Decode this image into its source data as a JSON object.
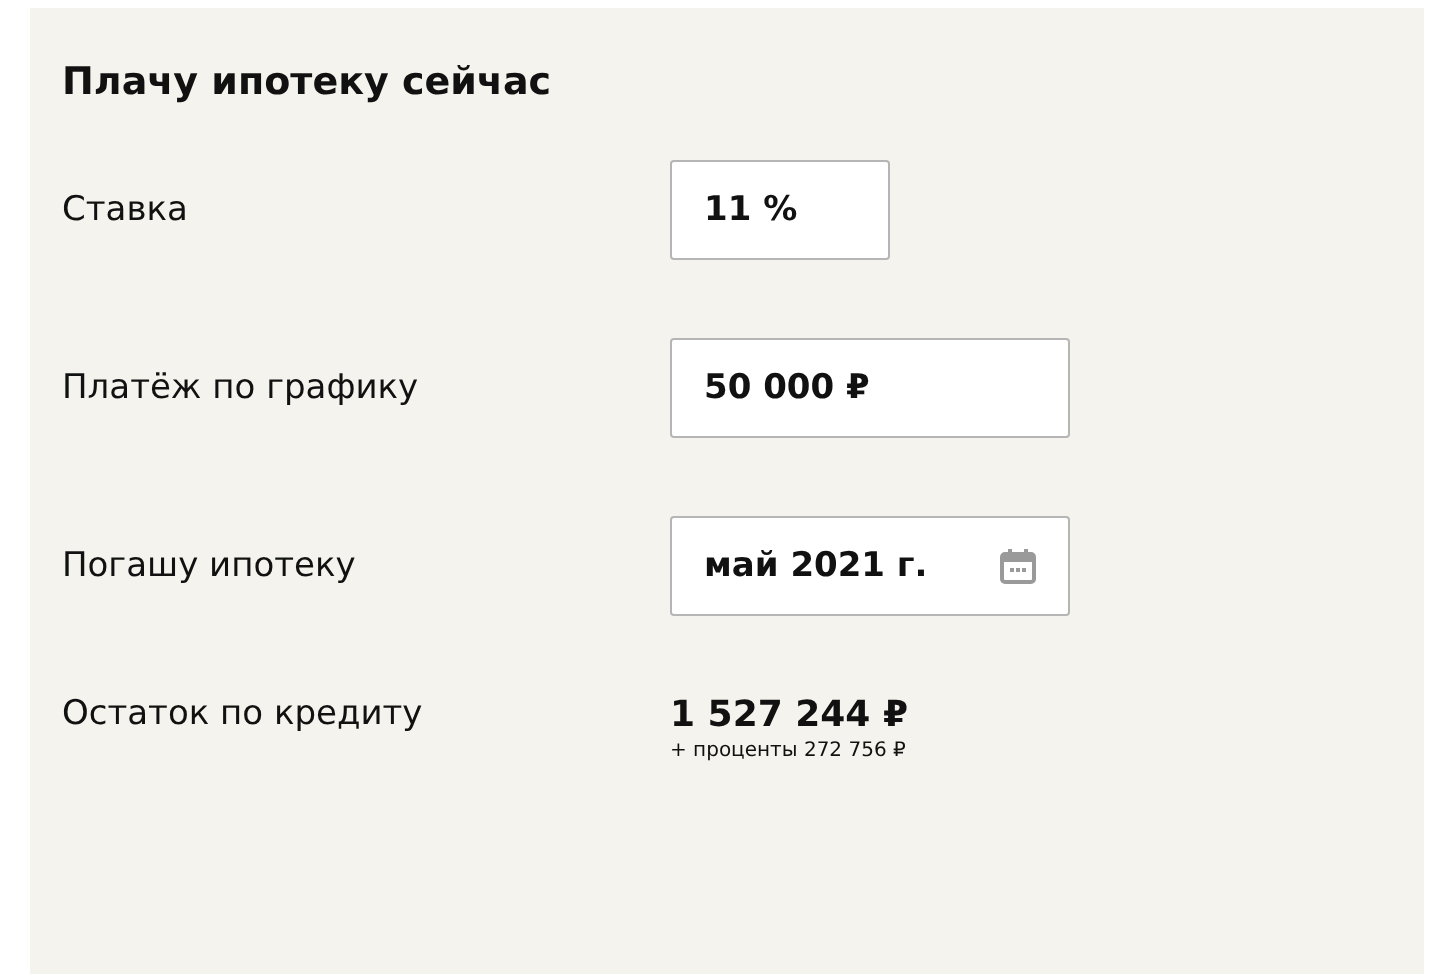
{
  "title": "Плачу ипотеку сейчас",
  "fields": [
    {
      "kind": "input",
      "label": "Ставка",
      "value": "11 %"
    },
    {
      "kind": "input",
      "label": "Платёж по графику",
      "value": "50 000 ₽"
    },
    {
      "kind": "date",
      "label": "Погашу ипотеку",
      "value": "май 2021 г."
    }
  ],
  "result": {
    "label": "Остаток по кредиту",
    "value": "1 527 244 ₽",
    "note": "+ проценты 272 756 ₽"
  }
}
